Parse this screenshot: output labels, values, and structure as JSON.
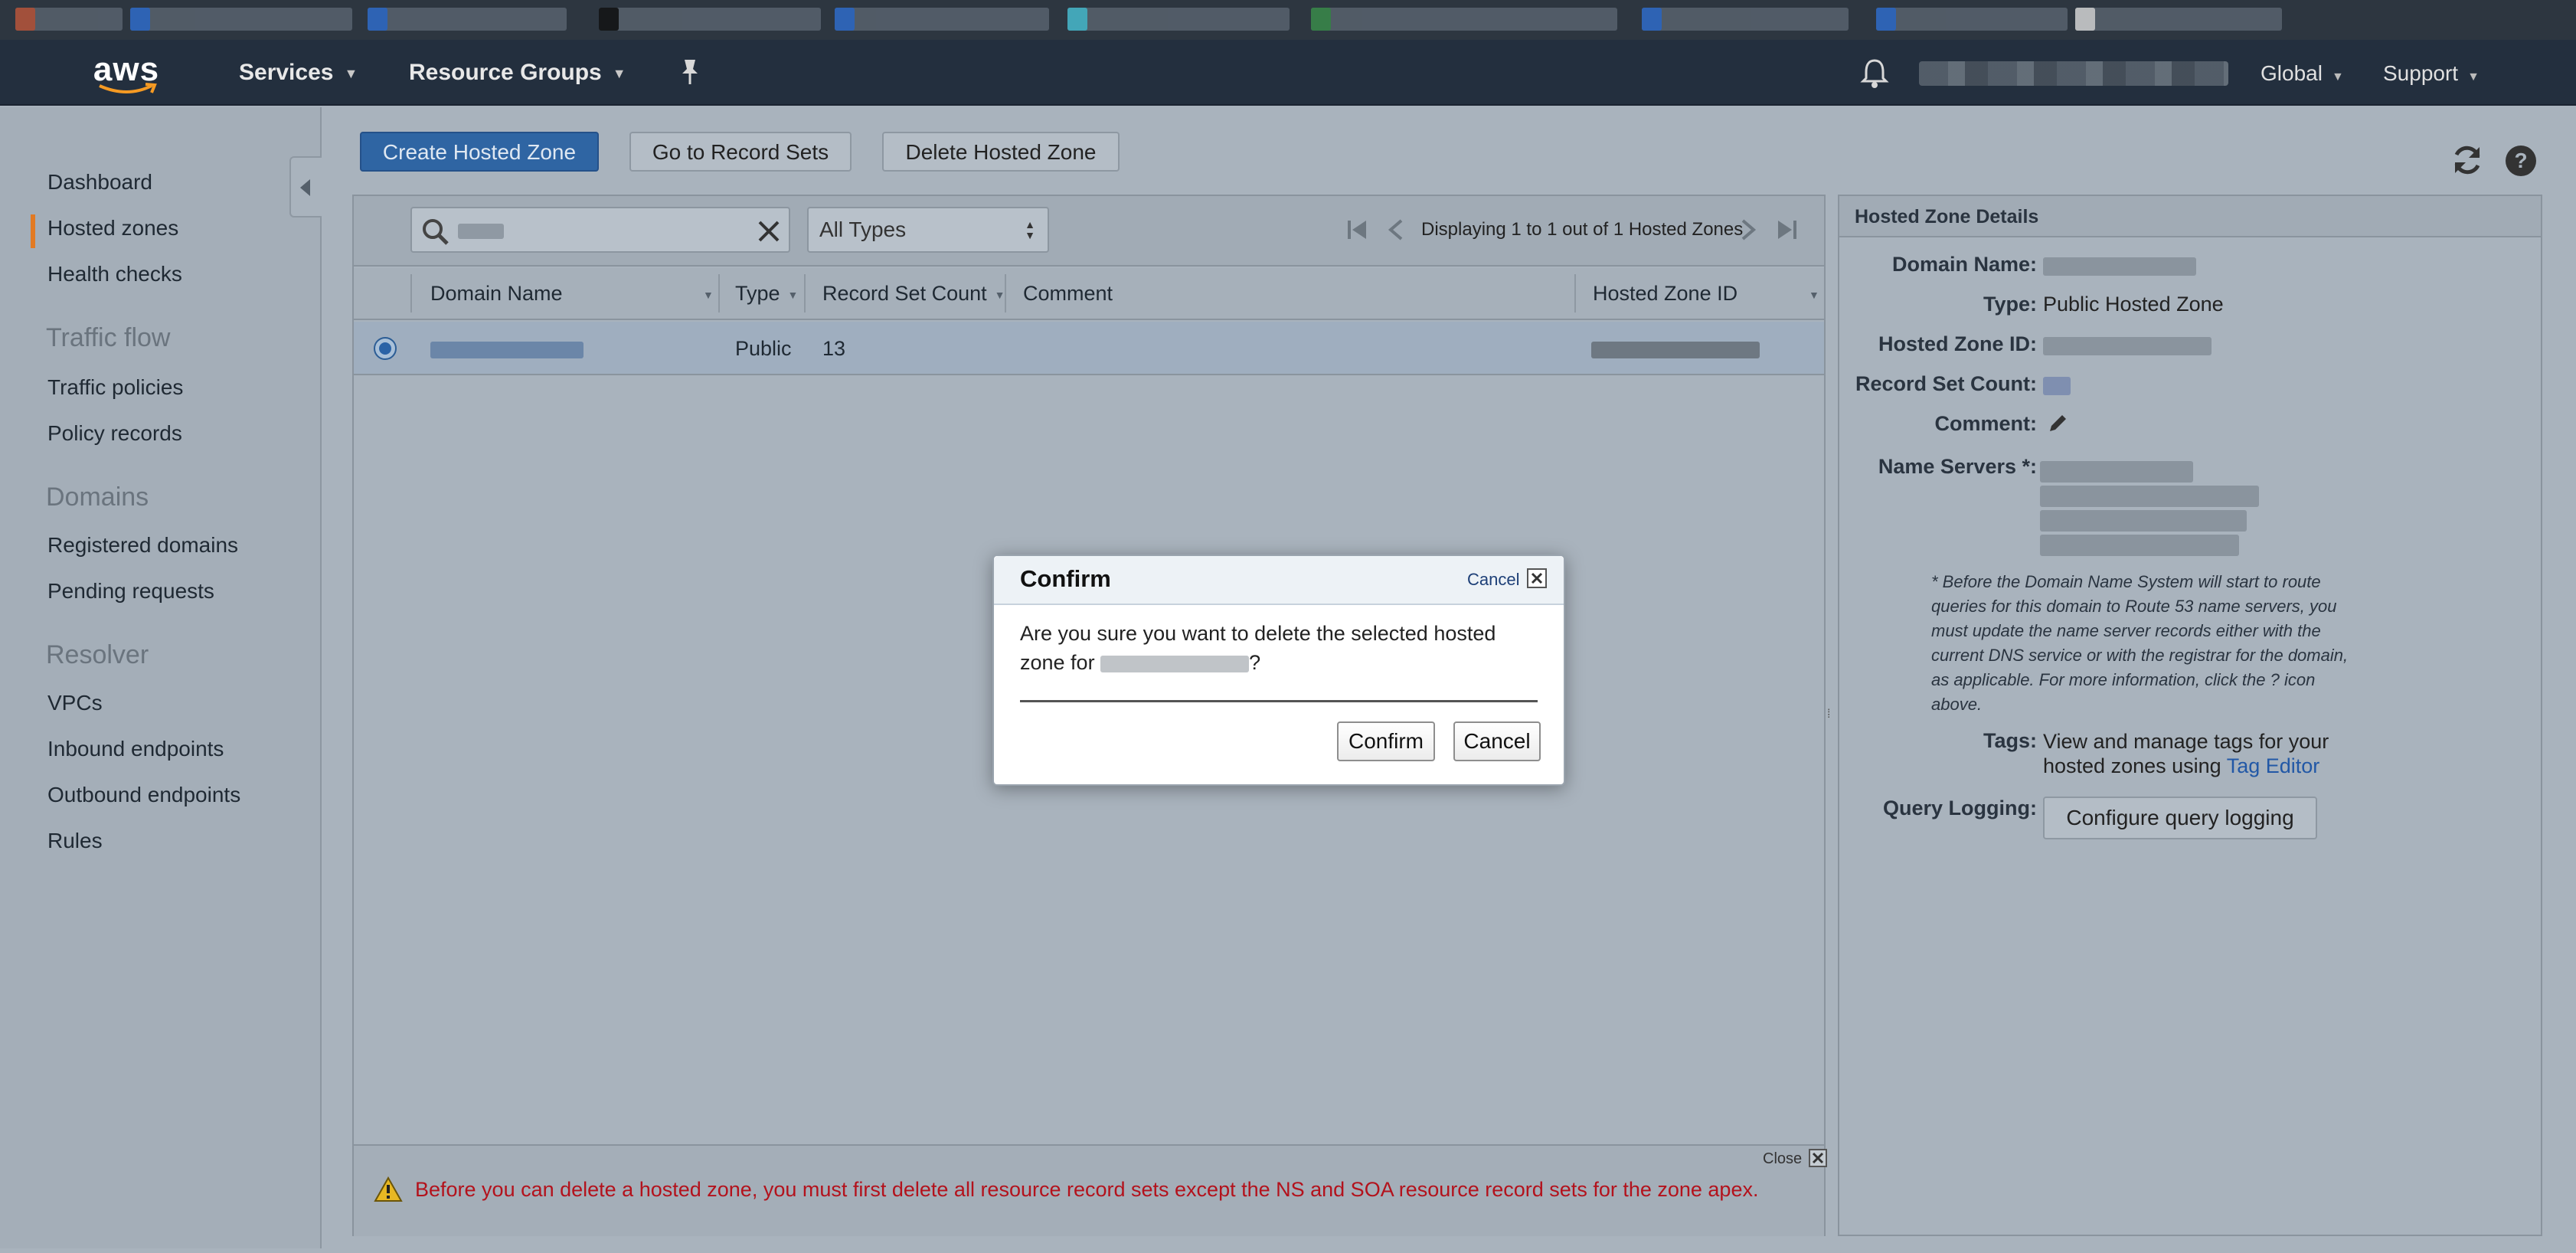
{
  "navbar": {
    "logo_text": "aws",
    "services_label": "Services",
    "resource_groups_label": "Resource Groups",
    "global_label": "Global",
    "support_label": "Support",
    "bg_color": "#232f3e"
  },
  "sidebar": {
    "dashboard": "Dashboard",
    "hosted_zones": "Hosted zones",
    "health_checks": "Health checks",
    "traffic_flow_section": "Traffic flow",
    "traffic_policies": "Traffic policies",
    "policy_records": "Policy records",
    "domains_section": "Domains",
    "registered_domains": "Registered domains",
    "pending_requests": "Pending requests",
    "resolver_section": "Resolver",
    "vpcs": "VPCs",
    "inbound_endpoints": "Inbound endpoints",
    "outbound_endpoints": "Outbound endpoints",
    "rules": "Rules",
    "active_item": "Hosted zones",
    "active_color": "#e27a23"
  },
  "toolbar": {
    "create_label": "Create Hosted Zone",
    "goto_label": "Go to Record Sets",
    "delete_label": "Delete Hosted Zone"
  },
  "filter": {
    "type_select_value": "All Types",
    "pager_text": "Displaying 1 to 1 out of 1 Hosted Zones"
  },
  "table": {
    "columns": {
      "domain_name": "Domain Name",
      "type": "Type",
      "record_set_count": "Record Set Count",
      "comment": "Comment",
      "hosted_zone_id": "Hosted Zone ID"
    },
    "rows": [
      {
        "type": "Public",
        "record_set_count": "13",
        "comment": ""
      }
    ]
  },
  "warning": {
    "text": "Before you can delete a hosted zone, you must first delete all resource record sets except the NS and SOA resource record sets for the zone apex.",
    "close_label": "Close",
    "color": "#b3121c"
  },
  "details": {
    "header": "Hosted Zone Details",
    "domain_name_label": "Domain Name:",
    "type_label": "Type:",
    "type_value": "Public Hosted Zone",
    "hosted_zone_id_label": "Hosted Zone ID:",
    "record_set_count_label": "Record Set Count:",
    "comment_label": "Comment:",
    "name_servers_label": "Name Servers *:",
    "ns_note": "* Before the Domain Name System will start to route queries for this domain to Route 53 name servers, you must update the name server records either with the current DNS service or with the registrar for the domain, as applicable. For more information, click the ? icon above.",
    "tags_label": "Tags:",
    "tags_text": "View and manage tags for your hosted zones using",
    "tag_editor_link": "Tag Editor",
    "query_logging_label": "Query Logging:",
    "query_logging_button": "Configure query logging"
  },
  "modal": {
    "title": "Confirm",
    "cancel_link": "Cancel",
    "message_prefix": "Are you sure you want to delete the selected hosted zone for",
    "message_suffix": "?",
    "confirm_button": "Confirm",
    "cancel_button": "Cancel"
  },
  "icons": {
    "pin": "pin-icon",
    "bell": "bell-icon",
    "refresh": "refresh-icon",
    "help": "help-icon",
    "search": "search-icon",
    "clear": "clear-icon",
    "warning": "warning-icon",
    "edit": "pencil-icon"
  }
}
